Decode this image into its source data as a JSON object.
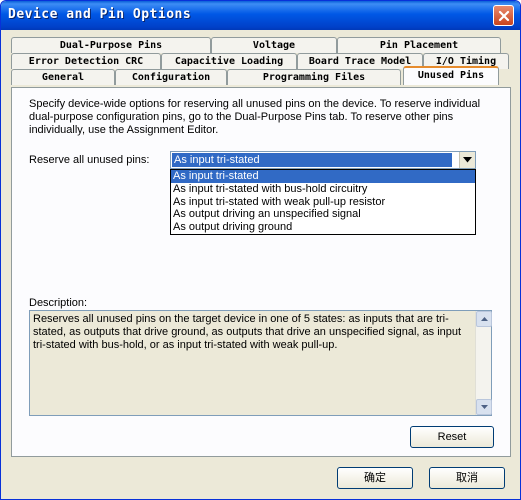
{
  "window": {
    "title": "Device and Pin Options"
  },
  "tabs": {
    "row1": [
      "Dual-Purpose Pins",
      "Voltage",
      "Pin Placement"
    ],
    "row2": [
      "Error Detection CRC",
      "Capacitive Loading",
      "Board Trace Model",
      "I/O Timing"
    ],
    "row3": [
      "General",
      "Configuration",
      "Programming Files",
      "Unused Pins"
    ],
    "active": "Unused Pins"
  },
  "unused_pins": {
    "intro": "Specify device-wide options for reserving all unused pins on the device. To reserve individual dual-purpose configuration pins, go to the Dual-Purpose Pins tab. To reserve other pins individually, use the Assignment Editor.",
    "reserve_label": "Reserve all unused pins:",
    "reserve_value": "As input tri-stated",
    "options": [
      "As input tri-stated",
      "As input tri-stated with bus-hold circuitry",
      "As input tri-stated with weak pull-up resistor",
      "As output driving an unspecified signal",
      "As output driving ground"
    ],
    "description_label": "Description:",
    "description": "Reserves all unused pins on the target device in one of 5 states: as inputs that are tri-stated, as outputs that drive ground, as outputs that drive an unspecified signal, as input tri-stated with bus-hold, or as input tri-stated with weak pull-up.",
    "reset_label": "Reset"
  },
  "footer": {
    "ok_label": "确定",
    "cancel_label": "取消"
  },
  "colors": {
    "titlebar": "#0058e6",
    "selection": "#316ac5",
    "active_tab_accent": "#e68b2c"
  }
}
